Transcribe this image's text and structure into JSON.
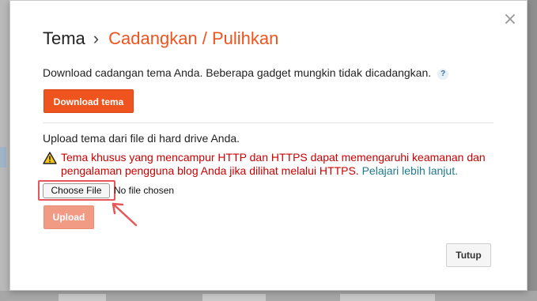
{
  "dialog": {
    "title": "Tema",
    "separator": "›",
    "subtitle": "Cadangkan / Pulihkan",
    "close_symbol": "×"
  },
  "backup": {
    "description": "Download cadangan tema Anda. Beberapa gadget mungkin tidak dicadangkan.",
    "help_symbol": "?",
    "download_label": "Download tema"
  },
  "upload": {
    "description": "Upload tema dari file di hard drive Anda.",
    "warning_text": "Tema khusus yang mencampur HTTP dan HTTPS dapat memengaruhi keamanan dan pengalaman pengguna blog Anda jika dilihat melalui HTTPS.",
    "learn_more_link": "Pelajari lebih lanjut.",
    "choose_file_label": "Choose File",
    "no_file_text": "No file chosen",
    "upload_label": "Upload"
  },
  "footer": {
    "close_label": "Tutup"
  },
  "colors": {
    "accent": "#f0541e",
    "warning": "#cc0000",
    "link": "#1f7a8c",
    "annotation": "#e8555a"
  }
}
